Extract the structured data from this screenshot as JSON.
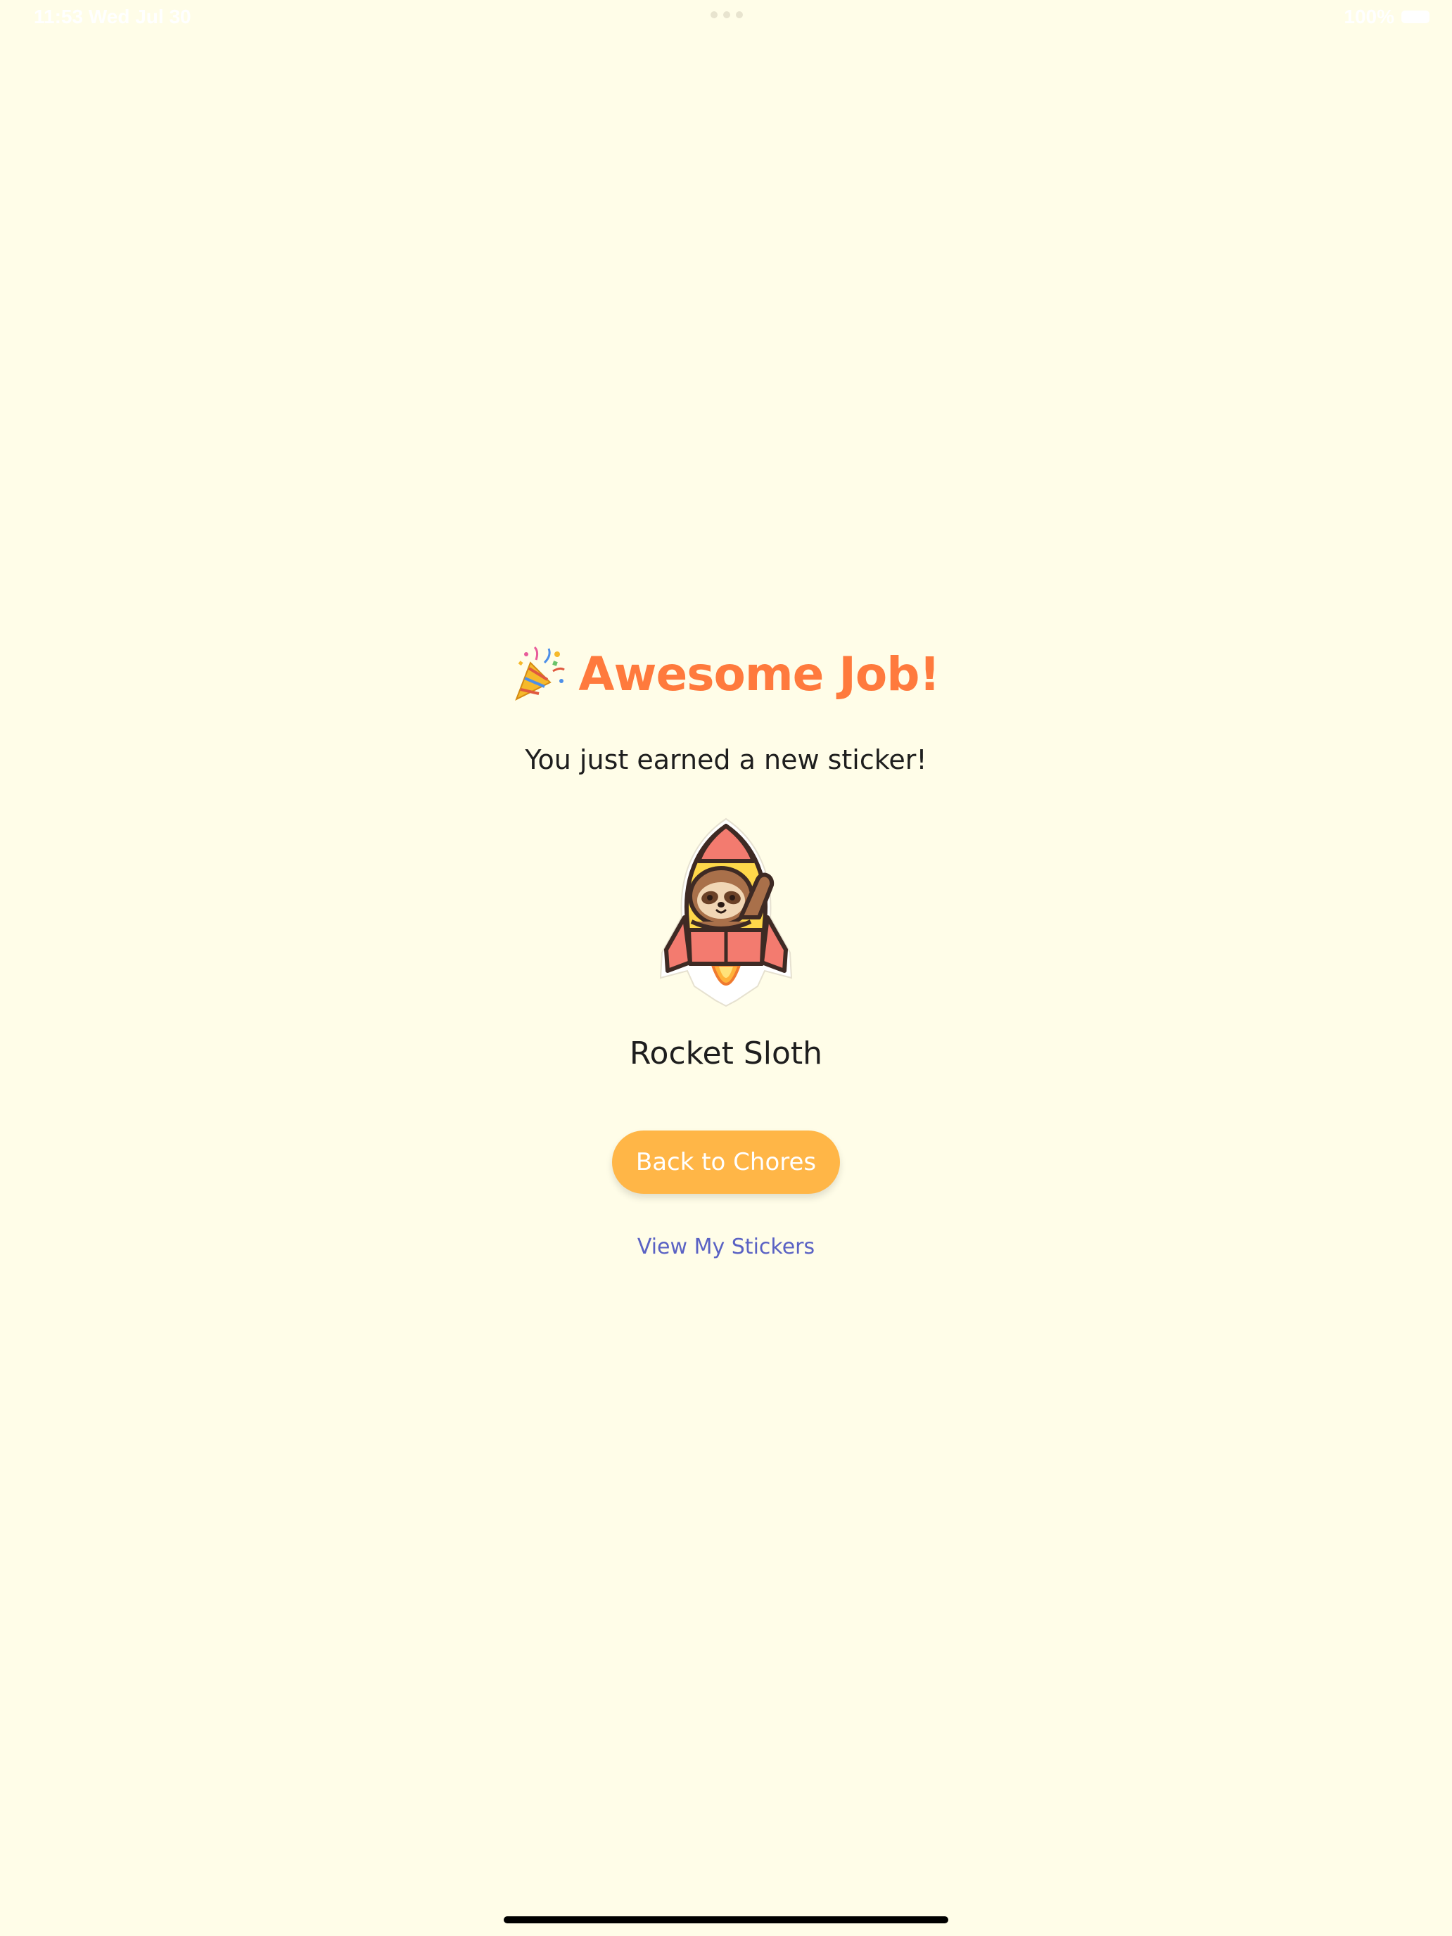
{
  "status_bar": {
    "time": "11:53",
    "date": "Wed Jul 30",
    "battery": "100%"
  },
  "celebration": {
    "icon": "party-popper-icon",
    "title": "Awesome Job!",
    "subtitle": "You just earned a new sticker!"
  },
  "sticker": {
    "image": "rocket-sloth-sticker",
    "name": "Rocket Sloth"
  },
  "actions": {
    "back_label": "Back to Chores",
    "view_label": "View My Stickers"
  },
  "colors": {
    "background": "#FFFDE8",
    "title": "#FF7A3D",
    "button": "#FFB647",
    "link": "#5A62C4"
  }
}
